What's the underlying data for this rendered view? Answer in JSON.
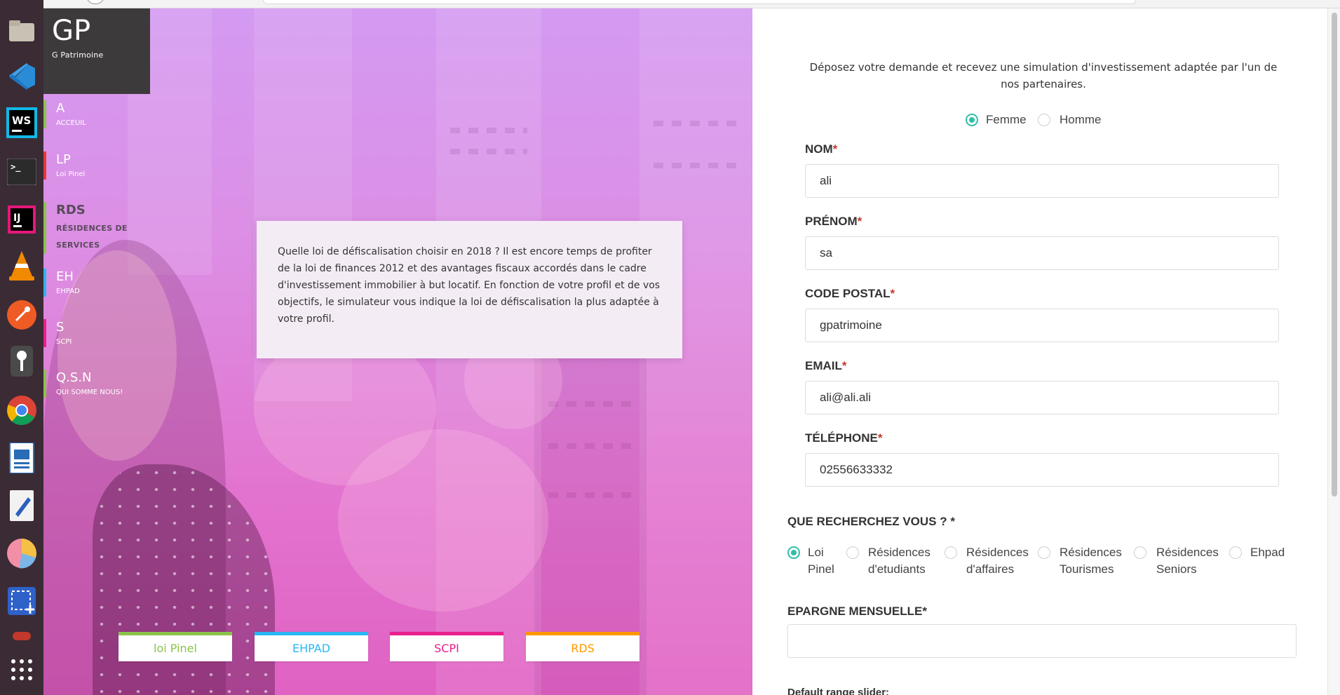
{
  "brand": {
    "initials": "GP",
    "name": "G Patrimoine"
  },
  "nav": [
    {
      "abbr": "A",
      "label": "ACCEUIL",
      "color": "#8bc34a"
    },
    {
      "abbr": "LP",
      "label": "Loi Pinel",
      "color": "#e53935"
    },
    {
      "abbr": "RDS",
      "label": "RÉSIDENCES DE SERVICES",
      "color": "#8bc34a"
    },
    {
      "abbr": "EH",
      "label": "EHPAD",
      "color": "#29b6f6"
    },
    {
      "abbr": "S",
      "label": "SCPI",
      "color": "#e91e8c"
    },
    {
      "abbr": "Q.S.N",
      "label": "QUI SOMME NOUS!",
      "color": "#8bc34a"
    }
  ],
  "info": {
    "text": "Quelle loi de défiscalisation choisir en 2018 ? Il est encore temps de profiter de la loi de finances 2012 et des avantages fiscaux accordés dans le cadre d'investissement immobilier à but locatif. En fonction de votre profil et de vos objectifs, le simulateur vous indique la loi de défiscalisation la plus adaptée à votre profil."
  },
  "categories": [
    {
      "label": "loi Pinel",
      "color": "#8bc34a"
    },
    {
      "label": "EHPAD",
      "color": "#29b6f6"
    },
    {
      "label": "SCPI",
      "color": "#e91e8c"
    },
    {
      "label": "RDS",
      "color": "#ff9800"
    }
  ],
  "form": {
    "intro": "Déposez votre demande et recevez une simulation d'investissement adaptée par l'un de nos partenaires.",
    "gender": {
      "options": [
        "Femme",
        "Homme"
      ],
      "selected": "Femme"
    },
    "fields": [
      {
        "label": "NOM",
        "value": "ali"
      },
      {
        "label": "PRÉNOM",
        "value": "sa"
      },
      {
        "label": "CODE POSTAL",
        "value": "gpatrimoine"
      },
      {
        "label": "EMAIL",
        "value": "ali@ali.ali"
      },
      {
        "label": "TÉLÉPHONE",
        "value": "02556633332"
      }
    ],
    "required_mark": "*",
    "search_question": "QUE RECHERCHEZ VOUS ? *",
    "search_options": [
      {
        "line1": "Loi",
        "line2": "Pinel"
      },
      {
        "line1": "Résidences",
        "line2": "d'etudiants"
      },
      {
        "line1": "Résidences",
        "line2": "d'affaires"
      },
      {
        "line1": "Résidences",
        "line2": "Tourismes"
      },
      {
        "line1": "Résidences",
        "line2": "Seniors"
      },
      {
        "line1": "Ehpad",
        "line2": ""
      }
    ],
    "search_selected": "Loi Pinel",
    "epargne_label": "EPARGNE MENSUELLE*",
    "epargne_value": "",
    "slider_label": "Default range slider:"
  },
  "colors": {
    "accent": "#2fbfa8",
    "required": "#c0392b",
    "sidebar_dark": "#3d3a3c"
  }
}
